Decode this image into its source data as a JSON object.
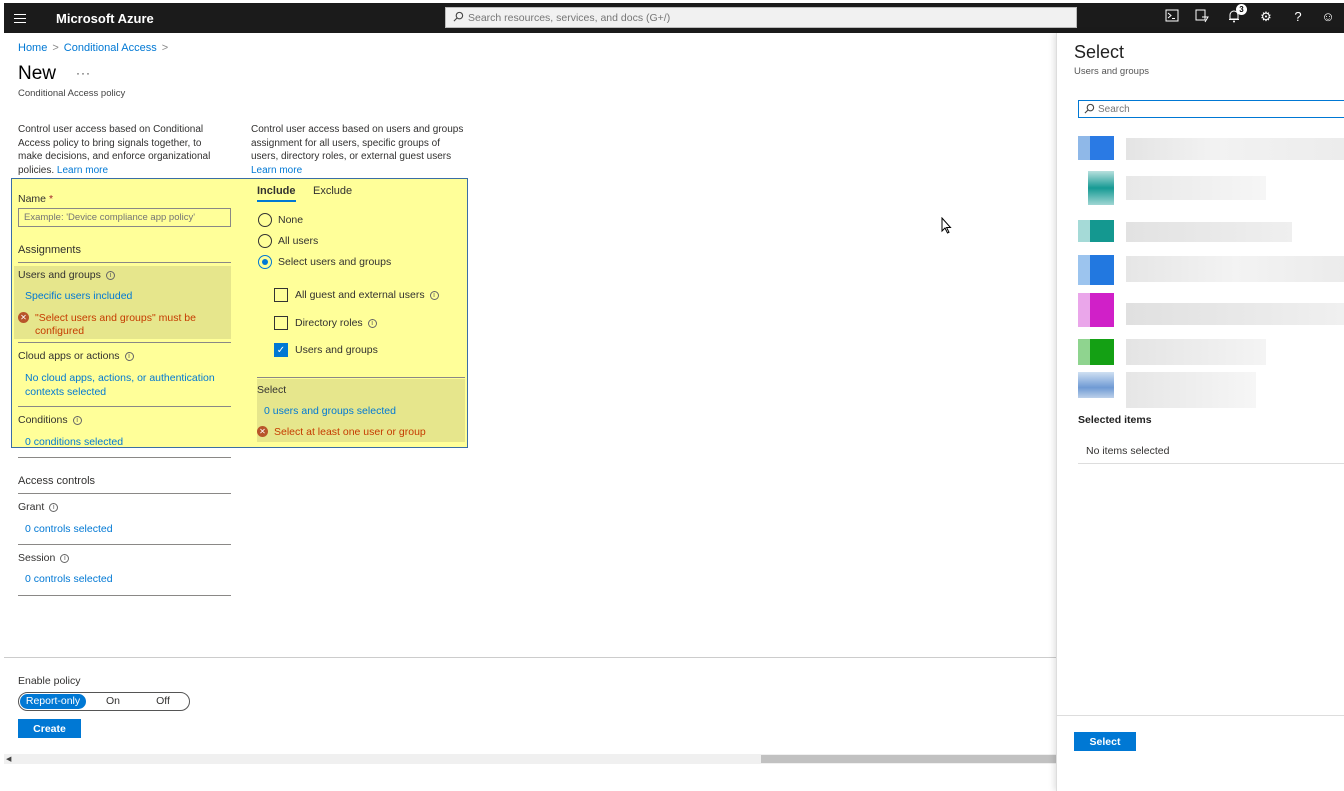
{
  "topbar": {
    "brand": "Microsoft Azure",
    "search_placeholder": "Search resources, services, and docs (G+/)",
    "notification_count": "3"
  },
  "breadcrumb": {
    "home": "Home",
    "section": "Conditional Access"
  },
  "page": {
    "title": "New",
    "more": "···",
    "subtitle": "Conditional Access policy"
  },
  "left_desc": {
    "lines": [
      "Control user access based on Conditional",
      "Access policy to bring signals together, to",
      "make decisions, and enforce organizational",
      "policies."
    ],
    "learn_more": "Learn more"
  },
  "right_desc": {
    "lines": [
      "Control user access based on users and groups",
      "assignment for all users, specific groups of",
      "users, directory roles, or external guest users"
    ],
    "learn_more": "Learn more"
  },
  "form": {
    "name_label": "Name",
    "name_required": "*",
    "name_placeholder": "Example: 'Device compliance app policy'",
    "assignments": "Assignments",
    "users_groups_label": "Users and groups",
    "users_groups_value": "Specific users included",
    "users_groups_error_1": "\"Select users and groups\" must be",
    "users_groups_error_2": "configured",
    "cloud_apps_label": "Cloud apps or actions",
    "cloud_apps_value_1": "No cloud apps, actions, or authentication",
    "cloud_apps_value_2": "contexts selected",
    "conditions_label": "Conditions",
    "conditions_value": "0 conditions selected",
    "access_controls": "Access controls",
    "grant_label": "Grant",
    "grant_value": "0 controls selected",
    "session_label": "Session",
    "session_value": "0 controls selected"
  },
  "include_panel": {
    "tabs": [
      "Include",
      "Exclude"
    ],
    "radios": [
      "None",
      "All users",
      "Select users and groups"
    ],
    "checkboxes": [
      "All guest and external users",
      "Directory roles",
      "Users and groups"
    ],
    "select_label": "Select",
    "select_value": "0 users and groups selected",
    "select_error": "Select at least one user or group"
  },
  "enable_policy": {
    "label": "Enable policy",
    "options": [
      "Report-only",
      "On",
      "Off"
    ],
    "selected": "Report-only",
    "create": "Create"
  },
  "side_panel": {
    "title": "Select",
    "subtitle": "Users and groups",
    "search_placeholder": "Search",
    "selected_items": "Selected items",
    "no_items": "No items selected",
    "select_button": "Select"
  },
  "colors": {
    "accent": "#0078d4",
    "highlight": "#ffff99",
    "error": "#c53b00"
  }
}
